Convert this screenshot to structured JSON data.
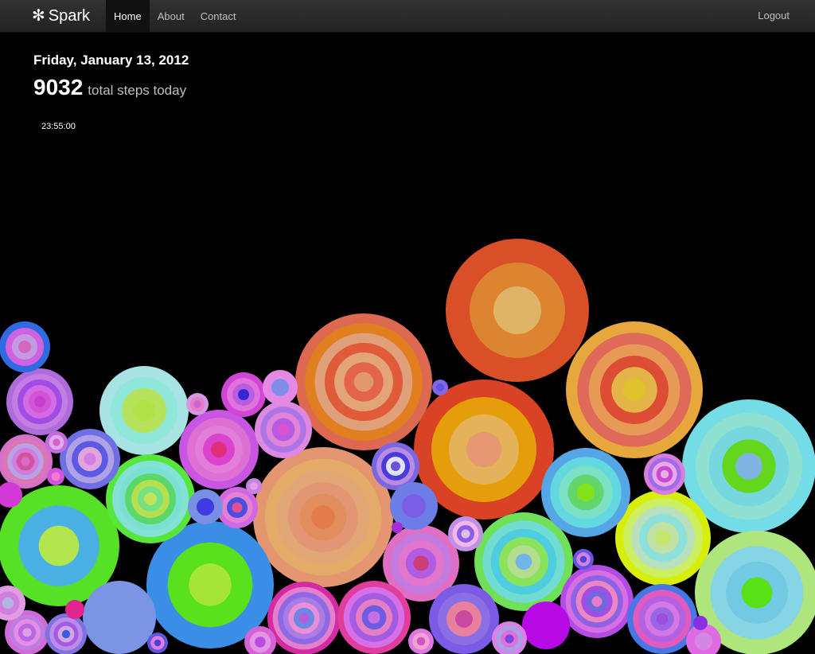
{
  "brand": {
    "name": "Spark",
    "icon": "asterisk-icon"
  },
  "nav": {
    "items": [
      {
        "label": "Home",
        "active": true
      },
      {
        "label": "About",
        "active": false
      },
      {
        "label": "Contact",
        "active": false
      }
    ],
    "logout_label": "Logout"
  },
  "summary": {
    "date": "Friday, January 13, 2012",
    "steps": "9032",
    "steps_label": "total steps today",
    "time": "23:55:00"
  },
  "colors": {
    "background": "#000000",
    "navbar": "#222222",
    "nav_active": "#111111",
    "nav_text": "#bfbfbf"
  }
}
